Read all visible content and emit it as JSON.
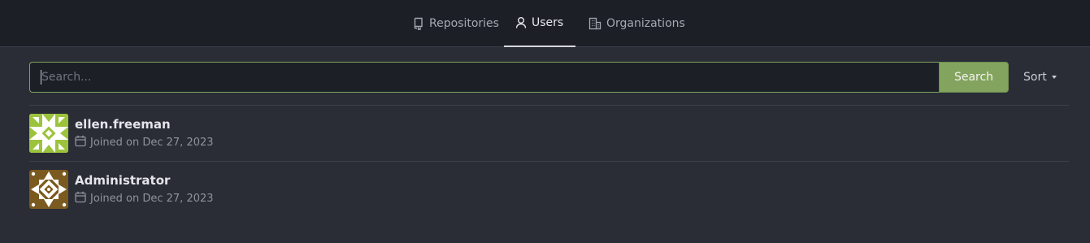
{
  "nav": {
    "tabs": [
      {
        "label": "Repositories",
        "icon": "repo-icon",
        "active": false
      },
      {
        "label": "Users",
        "icon": "person-icon",
        "active": true
      },
      {
        "label": "Organizations",
        "icon": "organization-icon",
        "active": false
      }
    ]
  },
  "search": {
    "placeholder": "Search...",
    "value": "",
    "button_label": "Search",
    "sort_label": "Sort"
  },
  "users": [
    {
      "name": "ellen.freeman",
      "joined": "Joined on Dec 27, 2023",
      "avatar_colors": [
        "#9cc33c",
        "#ffffff"
      ]
    },
    {
      "name": "Administrator",
      "joined": "Joined on Dec 27, 2023",
      "avatar_colors": [
        "#7a5a1e",
        "#ffffff"
      ]
    }
  ],
  "colors": {
    "accent": "#83a45e",
    "background": "#2a2c36",
    "header": "#1d1f26"
  }
}
